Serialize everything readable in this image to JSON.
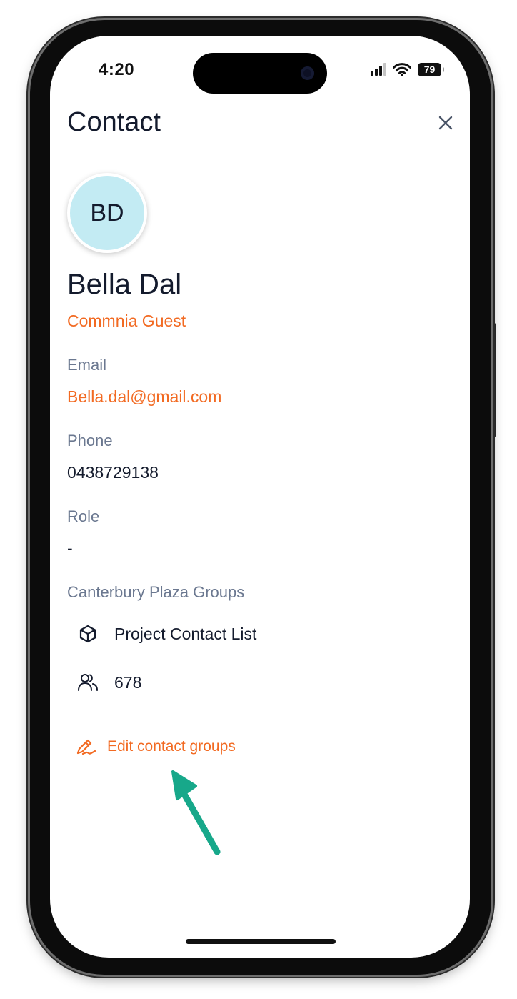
{
  "status_bar": {
    "time": "4:20",
    "battery": "79",
    "icons": [
      "cellular-signal-icon",
      "wifi-icon",
      "battery-icon"
    ]
  },
  "header": {
    "title": "Contact",
    "close_icon": "close-icon"
  },
  "contact": {
    "initials": "BD",
    "name": "Bella Dal",
    "type": "Commnia Guest"
  },
  "fields": {
    "email": {
      "label": "Email",
      "value": "Bella.dal@gmail.com"
    },
    "phone": {
      "label": "Phone",
      "value": "0438729138"
    },
    "role": {
      "label": "Role",
      "value": "-"
    }
  },
  "groups": {
    "heading": "Canterbury Plaza Groups",
    "items": [
      {
        "icon": "cube-icon",
        "label": "Project Contact List"
      },
      {
        "icon": "users-icon",
        "label": "678"
      }
    ]
  },
  "edit_groups": {
    "label": "Edit contact groups",
    "icon": "pen-signature-icon"
  },
  "colors": {
    "accent": "#f26a22",
    "text": "#141b2d",
    "label": "#6b7890",
    "avatar_bg": "#c3ebf3",
    "annotation_arrow": "#17a88a"
  }
}
